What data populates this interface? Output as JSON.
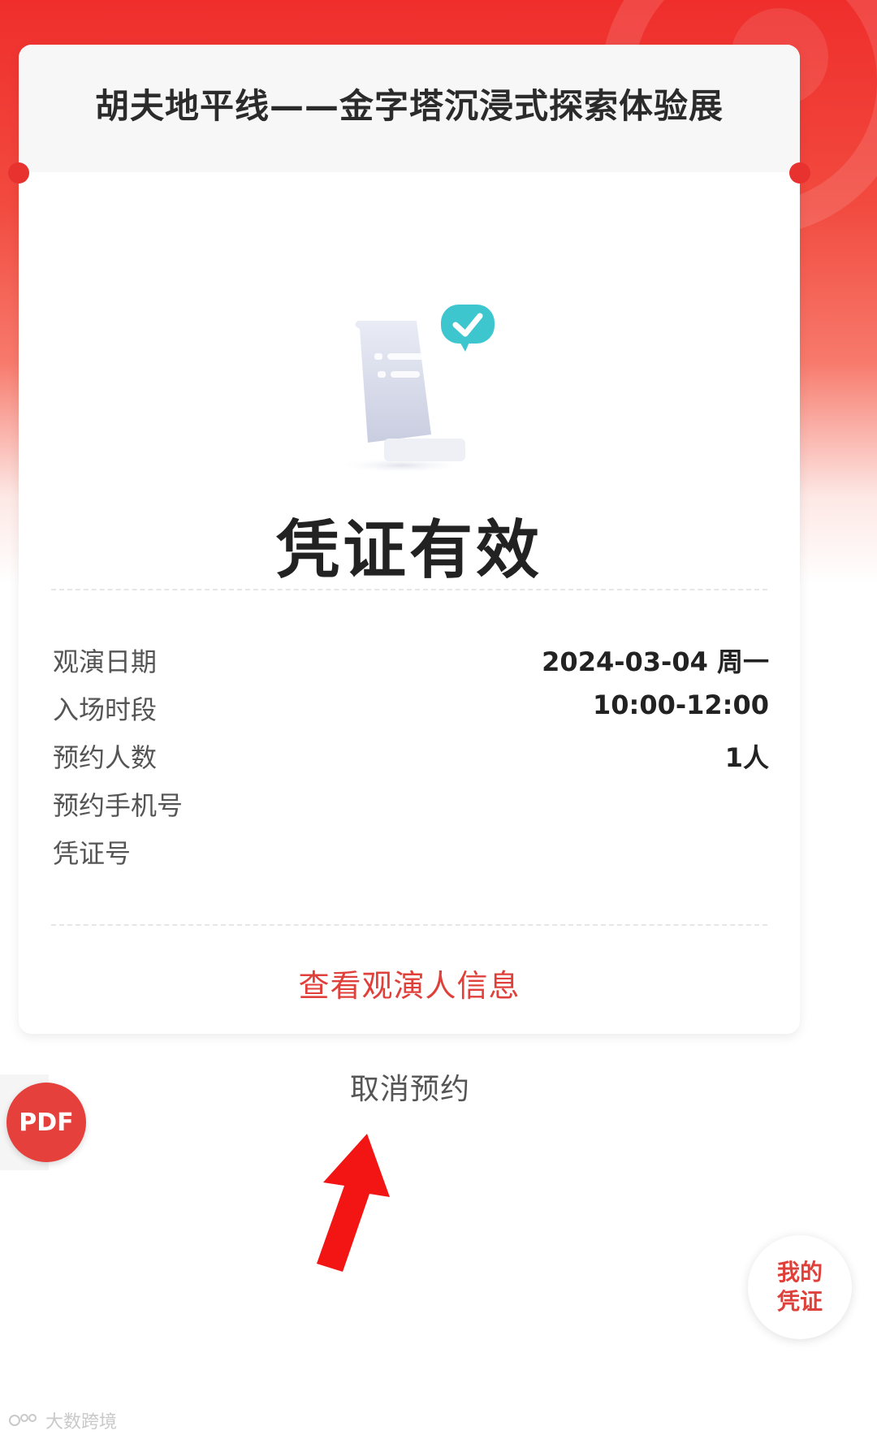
{
  "event": {
    "title": "胡夫地平线——金字塔沉浸式探索体验展"
  },
  "status": {
    "title": "凭证有效"
  },
  "details": [
    {
      "label": "观演日期",
      "value": "2024-03-04 周一"
    },
    {
      "label": "入场时段",
      "value": "10:00-12:00"
    },
    {
      "label": "预约人数",
      "value": "1人"
    },
    {
      "label": "预约手机号",
      "value": ""
    },
    {
      "label": "凭证号",
      "value": ""
    }
  ],
  "actions": {
    "view_audience": "查看观演人信息",
    "cancel_booking": "取消预约",
    "pdf": "PDF",
    "my_voucher_line1": "我的",
    "my_voucher_line2": "凭证"
  },
  "watermark": {
    "text": "大数跨境"
  },
  "colors": {
    "brand_red": "#e5403c",
    "link_red": "#e0403a",
    "check_teal": "#3ec6cf"
  },
  "icons": {
    "voucher": "voucher-check-icon",
    "arrow": "red-arrow-pointer",
    "watermark_logo": "brand-logo"
  }
}
